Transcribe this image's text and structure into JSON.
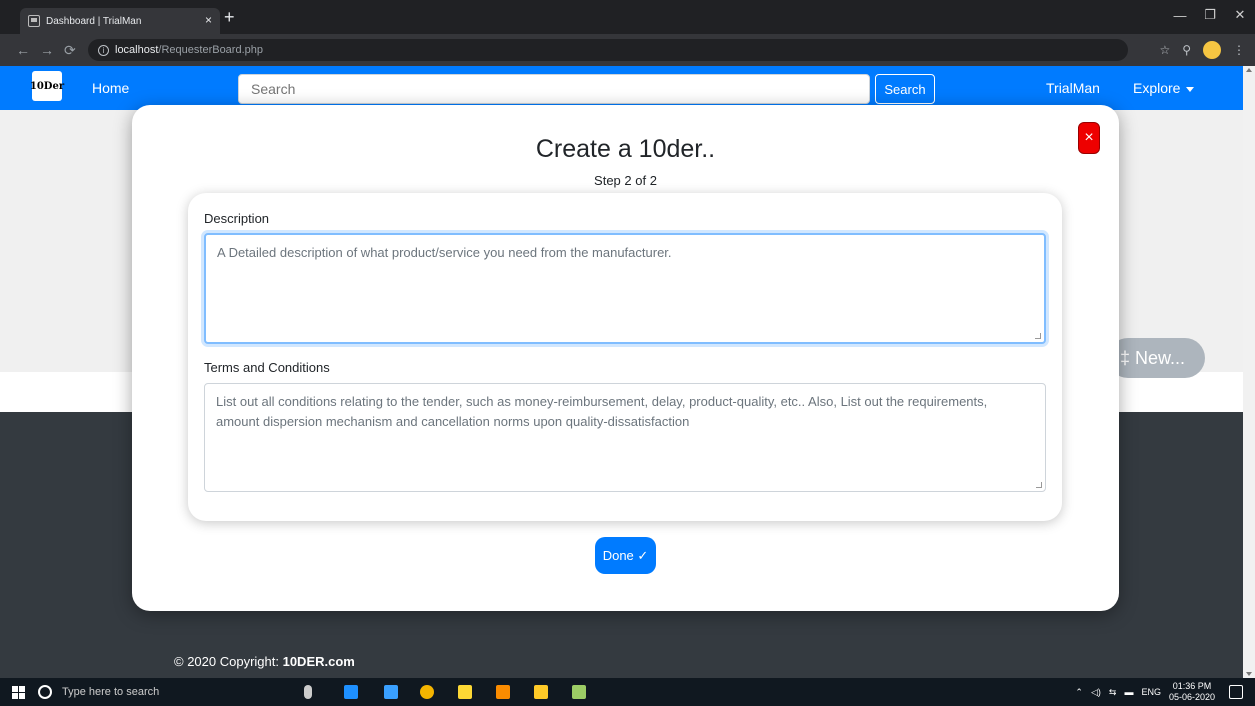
{
  "browser": {
    "tab_title": "Dashboard | TrialMan",
    "tab_close": "×",
    "new_tab": "+",
    "url_host": "localhost",
    "url_path": "/RequesterBoard.php",
    "window_min": "—",
    "window_max": "❐",
    "window_close": "✕"
  },
  "navbar": {
    "brand": "10Der",
    "home": "Home",
    "search_placeholder": "Search",
    "search_button": "Search",
    "user": "TrialMan",
    "explore": "Explore"
  },
  "page": {
    "new_button": "‡ New...",
    "copyright_prefix": "© 2020 Copyright: ",
    "copyright_site": "10DER.com"
  },
  "modal": {
    "title": "Create a 10der..",
    "step": "Step 2 of 2",
    "close": "×",
    "description_label": "Description",
    "description_placeholder": "A Detailed description of what product/service you need from the manufacturer.",
    "terms_label": "Terms and Conditions",
    "terms_placeholder": "List out all conditions relating to the tender, such as money-reimbursement, delay, product-quality, etc.. Also, List out the requirements, amount dispersion mechanism and cancellation norms upon quality-dissatisfaction",
    "done_button": "Done ✓"
  },
  "taskbar": {
    "search_placeholder": "Type here to search",
    "language": "ENG",
    "time": "01:36 PM",
    "date": "05-06-2020"
  }
}
